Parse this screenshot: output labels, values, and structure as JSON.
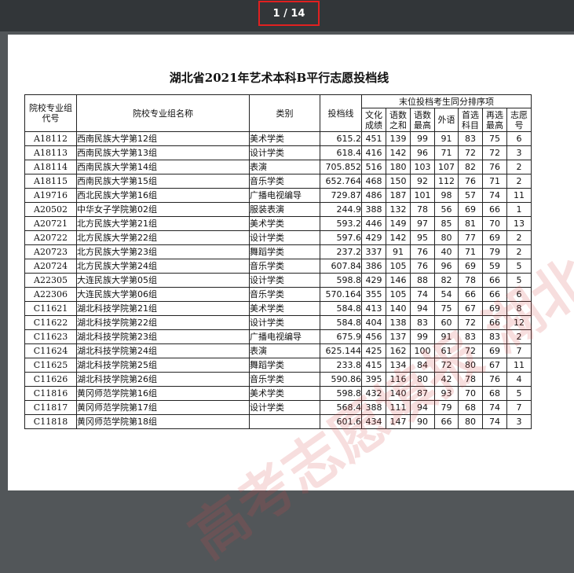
{
  "viewer": {
    "page_indicator": "1 / 14"
  },
  "document": {
    "title": "湖北省2021年艺术本科B平行志愿投档线",
    "watermark": "高考志愿填报 湖北招生",
    "headers": {
      "code": "院校专业组代号",
      "name": "院校专业组名称",
      "category": "类别",
      "score": "投档线",
      "group": "末位投档考生同分排序项",
      "sub": [
        "文化成绩",
        "语数之和",
        "语数最高",
        "外语",
        "首选科目",
        "再选最高",
        "志愿号"
      ]
    },
    "rows": [
      [
        "A18112",
        "西南民族大学第12组",
        "美术学类",
        "615.2",
        "451",
        "139",
        "99",
        "91",
        "83",
        "75",
        "6"
      ],
      [
        "A18113",
        "西南民族大学第13组",
        "设计学类",
        "618.4",
        "416",
        "142",
        "96",
        "71",
        "72",
        "72",
        "3"
      ],
      [
        "A18114",
        "西南民族大学第14组",
        "表演",
        "705.852",
        "516",
        "180",
        "103",
        "107",
        "82",
        "76",
        "2"
      ],
      [
        "A18115",
        "西南民族大学第15组",
        "音乐学类",
        "652.764",
        "468",
        "150",
        "92",
        "112",
        "76",
        "71",
        "2"
      ],
      [
        "A19716",
        "西北民族大学第16组",
        "广播电视编导",
        "729.87",
        "486",
        "187",
        "101",
        "98",
        "57",
        "74",
        "11"
      ],
      [
        "A20502",
        "中华女子学院第02组",
        "服装表演",
        "244.9",
        "388",
        "132",
        "78",
        "56",
        "69",
        "66",
        "1"
      ],
      [
        "A20721",
        "北方民族大学第21组",
        "美术学类",
        "593.2",
        "446",
        "149",
        "97",
        "85",
        "81",
        "70",
        "13"
      ],
      [
        "A20722",
        "北方民族大学第22组",
        "设计学类",
        "597.6",
        "429",
        "142",
        "95",
        "80",
        "77",
        "69",
        "2"
      ],
      [
        "A20723",
        "北方民族大学第23组",
        "舞蹈学类",
        "237.2",
        "337",
        "91",
        "76",
        "40",
        "71",
        "79",
        "2"
      ],
      [
        "A20724",
        "北方民族大学第24组",
        "音乐学类",
        "607.84",
        "386",
        "105",
        "76",
        "96",
        "69",
        "59",
        "5"
      ],
      [
        "A22305",
        "大连民族大学第05组",
        "设计学类",
        "598.8",
        "429",
        "146",
        "88",
        "82",
        "78",
        "66",
        "5"
      ],
      [
        "A22306",
        "大连民族大学第06组",
        "音乐学类",
        "570.164",
        "355",
        "105",
        "74",
        "54",
        "66",
        "66",
        "6"
      ],
      [
        "C11621",
        "湖北科技学院第21组",
        "美术学类",
        "584.8",
        "413",
        "140",
        "94",
        "75",
        "67",
        "69",
        "8"
      ],
      [
        "C11622",
        "湖北科技学院第22组",
        "设计学类",
        "584.8",
        "404",
        "138",
        "83",
        "60",
        "72",
        "66",
        "12"
      ],
      [
        "C11623",
        "湖北科技学院第23组",
        "广播电视编导",
        "675.9",
        "456",
        "137",
        "99",
        "91",
        "83",
        "83",
        "2"
      ],
      [
        "C11624",
        "湖北科技学院第24组",
        "表演",
        "625.144",
        "425",
        "162",
        "100",
        "61",
        "72",
        "69",
        "7"
      ],
      [
        "C11625",
        "湖北科技学院第25组",
        "舞蹈学类",
        "233.8",
        "415",
        "134",
        "84",
        "72",
        "80",
        "67",
        "11"
      ],
      [
        "C11626",
        "湖北科技学院第26组",
        "音乐学类",
        "590.86",
        "395",
        "116",
        "80",
        "42",
        "78",
        "76",
        "4"
      ],
      [
        "C11816",
        "黄冈师范学院第16组",
        "美术学类",
        "598.8",
        "432",
        "140",
        "87",
        "93",
        "70",
        "68",
        "5"
      ],
      [
        "C11817",
        "黄冈师范学院第17组",
        "设计学类",
        "568.4",
        "388",
        "111",
        "94",
        "79",
        "68",
        "74",
        "7"
      ],
      [
        "C11818",
        "黄冈师范学院第18组",
        "",
        "601.6",
        "434",
        "147",
        "90",
        "66",
        "80",
        "74",
        "3"
      ]
    ]
  },
  "colors": {
    "viewer_bg": "#525659",
    "toolbar_bg": "#323639",
    "highlight_border": "#e02020",
    "watermark": "#d24646"
  }
}
